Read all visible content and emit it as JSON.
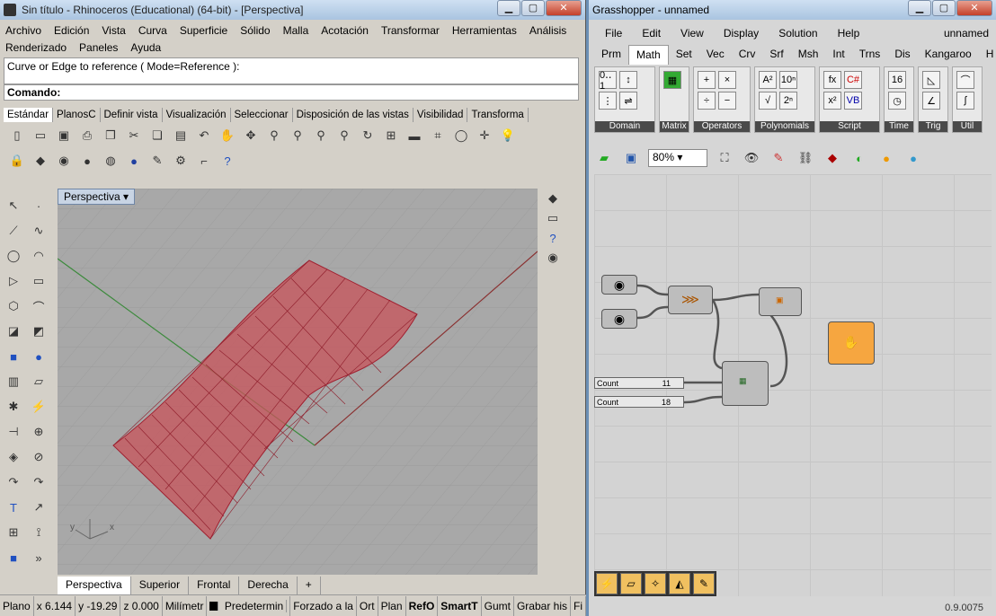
{
  "rhino": {
    "title": "Sin título - Rhinoceros (Educational) (64-bit) - [Perspectiva]",
    "menu": [
      "Archivo",
      "Edición",
      "Vista",
      "Curva",
      "Superficie",
      "Sólido",
      "Malla",
      "Acotación",
      "Transformar",
      "Herramientas",
      "Análisis",
      "Renderizado",
      "Paneles",
      "Ayuda"
    ],
    "command_history": "Curve or Edge to reference ( Mode=Reference ):",
    "command_label": "Comando:",
    "toolbar_tabs": [
      "Estándar",
      "PlanosC",
      "Definir vista",
      "Visualización",
      "Seleccionar",
      "Disposición de las vistas",
      "Visibilidad",
      "Transforma"
    ],
    "viewport_label": "Perspectiva",
    "view_tabs": [
      "Perspectiva",
      "Superior",
      "Frontal",
      "Derecha",
      "+"
    ],
    "status": [
      "Plano",
      "x 6.144",
      "y -19.29",
      "z 0.000",
      "Milímetr",
      "Predetermin",
      "Forzado a la",
      "Ort",
      "Plan",
      "RefO",
      "SmartT",
      "Gumt",
      "Grabar his",
      "Fi"
    ]
  },
  "gh": {
    "title": "Grasshopper - unnamed",
    "menu": [
      "File",
      "Edit",
      "View",
      "Display",
      "Solution",
      "Help"
    ],
    "doc_name": "unnamed",
    "tabs": [
      "Prm",
      "Math",
      "Set",
      "Vec",
      "Crv",
      "Srf",
      "Msh",
      "Int",
      "Trns",
      "Dis",
      "Kangaroo",
      "H"
    ],
    "groups": [
      "Domain",
      "Matrix",
      "Operators",
      "Polynomials",
      "Script",
      "Time",
      "Trig",
      "Util"
    ],
    "zoom": "80%",
    "slider1": {
      "label": "Count",
      "value": "11"
    },
    "slider2": {
      "label": "Count",
      "value": "18"
    },
    "version": "0.9.0075"
  }
}
